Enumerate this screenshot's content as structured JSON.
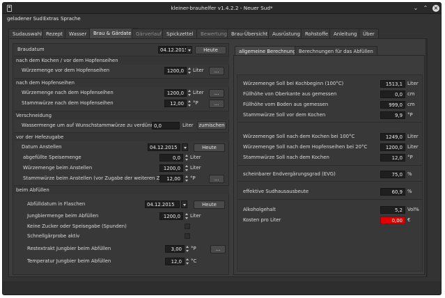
{
  "window": {
    "title": "kleiner-brauhelfer v1.4.2.2 - Neuer Sud*"
  },
  "menu": [
    "geladener Sud",
    "Extras",
    "Sprache"
  ],
  "tabs": [
    {
      "label": "Sudauswahl",
      "state": "normal"
    },
    {
      "label": "Rezept",
      "state": "normal"
    },
    {
      "label": "Wasser",
      "state": "normal"
    },
    {
      "label": "Brau & Gärdaten",
      "state": "active"
    },
    {
      "label": "Gärverlauf",
      "state": "disabled"
    },
    {
      "label": "Spickzettel",
      "state": "normal"
    },
    {
      "label": "Bewertung",
      "state": "disabled"
    },
    {
      "label": "Brau-Übersicht",
      "state": "normal"
    },
    {
      "label": "Ausrüstung",
      "state": "normal"
    },
    {
      "label": "Rohstoffe",
      "state": "normal"
    },
    {
      "label": "Anleitung",
      "state": "normal"
    },
    {
      "label": "Über",
      "state": "normal"
    }
  ],
  "left": {
    "braudatum": {
      "label": "Braudatum",
      "value": "04.12.2015",
      "button": "Heute"
    },
    "sec1": "nach dem Kochen / vor dem Hopfenseihen",
    "wuerze_vor": {
      "label": "Würzemenge vor dem Hopfenseihen",
      "value": "1200,0",
      "unit": "Liter",
      "button": "..."
    },
    "sec2": "nach dem Hopfenseihen",
    "wuerze_nach": {
      "label": "Würzemenge nach dem Hopfenseihen",
      "value": "1200,0",
      "unit": "Liter",
      "button": "..."
    },
    "stamm_nach": {
      "label": "Stammwürze nach dem Hopfenseihen",
      "value": "12,00",
      "unit": "°P",
      "button": "..."
    },
    "sec3": "Verschneidung",
    "wasser_verd": {
      "label": "Wassermenge um auf Wunschstammwürze zu verdünnen",
      "value": "0,0",
      "unit": "Liter",
      "button": "zumischen"
    },
    "sec4": "vor der Hefezugabe",
    "datum_anstellen": {
      "label": "Datum Anstellen",
      "value": "04.12.2015",
      "button": "Heute"
    },
    "speisemenge": {
      "label": "abgefüllte Speisemenge",
      "value": "0,0",
      "unit": "Liter"
    },
    "wuerze_anst": {
      "label": "Würzemenge beim Anstellen",
      "value": "1200,0",
      "unit": "Liter"
    },
    "stamm_anst": {
      "label": "Stammwürze beim Anstellen (vor Zugabe der weiteren Zutaten)",
      "value": "12,00",
      "unit": "°P",
      "button": "..."
    },
    "sec5": "beim Abfüllen",
    "abfuelldatum": {
      "label": "Abfülldatum in Flaschen",
      "value": "04.12.2015",
      "button": "Heute"
    },
    "jungbier": {
      "label": "Jungbiermenge beim Abfüllen",
      "value": "1200,0",
      "unit": "Liter"
    },
    "kein_zucker": {
      "label": "Keine Zucker oder Speisegabe (Spunden)"
    },
    "schnellgaer": {
      "label": "Schnellgärprobe aktiv"
    },
    "restextrakt": {
      "label": "Restextrakt Jungbier beim Abfüllen",
      "value": "3,00",
      "unit": "°P",
      "button": "..."
    },
    "temperatur": {
      "label": "Temperatur Jungbier beim Abfüllen",
      "value": "12,0",
      "unit": "°C"
    }
  },
  "right": {
    "tabs": [
      "allgemeine Berechnungen",
      "Berechnungen für das Abfüllen"
    ],
    "rows": [
      {
        "label": "Würzemenge Soll bei Kochbeginn (100°C)",
        "value": "1513,1",
        "unit": "Liter"
      },
      {
        "label": "Füllhöhe von Oberkante aus gemessen",
        "value": "0,0",
        "unit": "cm"
      },
      {
        "label": "Füllhöhe vom Boden aus gemessen",
        "value": "999,0",
        "unit": "cm"
      },
      {
        "label": "Stammwürze Soll vor dem Kochen",
        "value": "9,9",
        "unit": "°P"
      },
      {
        "label": "Würzemenge Soll nach dem Kochen bei 100°C",
        "value": "1249,0",
        "unit": "Liter"
      },
      {
        "label": "Würzemenge Soll nach dem Hopfenseihen bei 20°C",
        "value": "1200,0",
        "unit": "Liter"
      },
      {
        "label": "Stammwürze Soll nach dem Kochen",
        "value": "12,0",
        "unit": "°P"
      },
      {
        "label": "scheinbarer Endvergärungsgrad (EVG)",
        "value": "75,0",
        "unit": "%"
      },
      {
        "label": "effektive Sudhausausbeute",
        "value": "60,9",
        "unit": "%"
      },
      {
        "label": "Alkoholgehalt",
        "value": "5,2",
        "unit": "Vol%"
      },
      {
        "label": "Kosten pro Liter",
        "value": "0,00",
        "unit": "€"
      }
    ]
  },
  "colors": {
    "warning": "#e00000"
  }
}
